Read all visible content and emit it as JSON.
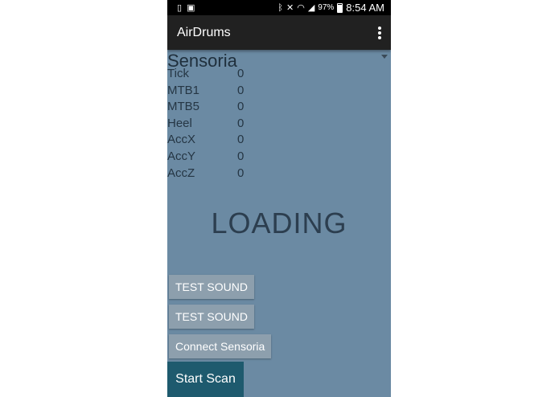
{
  "status_bar": {
    "battery_percent": "97%",
    "time": "8:54 AM"
  },
  "action_bar": {
    "title": "AirDrums"
  },
  "device_spinner": {
    "selected": "Sensoria"
  },
  "readings": [
    {
      "label": "Tick",
      "value": "0"
    },
    {
      "label": "MTB1",
      "value": "0"
    },
    {
      "label": "MTB5",
      "value": "0"
    },
    {
      "label": "Heel",
      "value": "0"
    },
    {
      "label": "AccX",
      "value": "0"
    },
    {
      "label": "AccY",
      "value": "0"
    },
    {
      "label": "AccZ",
      "value": "0"
    }
  ],
  "loading_text": "LOADING",
  "buttons": {
    "test_sound_1": "TEST SOUND",
    "test_sound_2": "TEST SOUND",
    "connect": "Connect Sensoria",
    "start_scan": "Start Scan"
  },
  "colors": {
    "background": "#6b8aa3",
    "action_bar": "#212121",
    "button": "#8d9fad",
    "scan_button": "#1e5a6e"
  }
}
